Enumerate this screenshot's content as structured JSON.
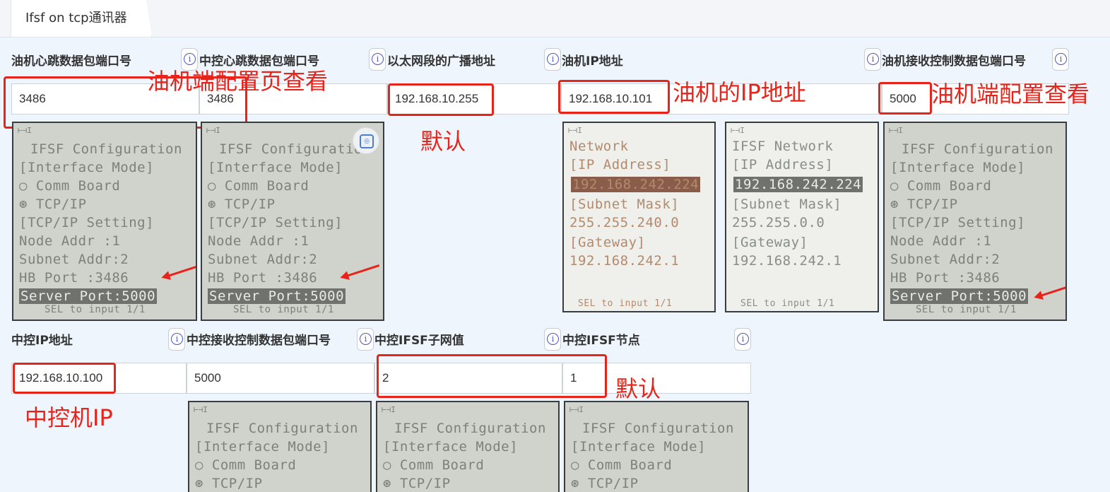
{
  "window": {
    "tab_title": "Ifsf on tcp通讯器"
  },
  "fields_row1": [
    {
      "label": "油机心跳数据包端口号",
      "value": "3486"
    },
    {
      "label": "中控心跳数据包端口号",
      "value": "3486"
    },
    {
      "label": "以太网段的广播地址",
      "value": "192.168.10.255"
    },
    {
      "label": "油机IP地址",
      "value": "192.168.10.101"
    },
    {
      "label": "油机接收控制数据包端口号",
      "value": "5000"
    }
  ],
  "fields_row2": [
    {
      "label": "中控IP地址",
      "value": "192.168.10.100"
    },
    {
      "label": "中控接收控制数据包端口号",
      "value": "5000"
    },
    {
      "label": "中控IFSF子网值",
      "value": "2"
    },
    {
      "label": "中控IFSF节点",
      "value": "1"
    }
  ],
  "info_glyph": "i",
  "annotations": {
    "a1": "油机端配置页查看",
    "a2": "默认",
    "a3": "油机的IP地址",
    "a4": "油机端配置查看",
    "a5": "中控机IP",
    "a6": "默认"
  },
  "lcd_config": {
    "top": "⊢⊣I",
    "lines": [
      "IFSF Configuration",
      "[Interface Mode]",
      "○ Comm Board",
      "⊛ TCP/IP",
      "[TCP/IP Setting]",
      "Node Addr  :1",
      "Subnet Addr:2",
      "HB Port    :3486",
      "Server Port:5000",
      "SEL to input 1/1"
    ]
  },
  "lcd_network_a": {
    "top": "⊢⊣I",
    "lines": [
      "Network",
      "[IP Address]",
      "192.168.242.224",
      "[Subnet Mask]",
      "255.255.240.0",
      "[Gateway]",
      "192.168.242.1",
      "SEL to input 1/1"
    ]
  },
  "lcd_network_b": {
    "top": "⊢⊣I",
    "lines": [
      "IFSF Network",
      "[IP Address]",
      "192.168.242.224",
      "[Subnet Mask]",
      "255.255.0.0",
      "[Gateway]",
      "192.168.242.1",
      "SEL to input 1/1"
    ]
  },
  "icons": {
    "info": "info-icon",
    "scan": "scan-icon"
  },
  "colors": {
    "annotation_red": "#e8231a",
    "info_blue": "#4a55c9",
    "page_bg": "#eef5fd"
  }
}
